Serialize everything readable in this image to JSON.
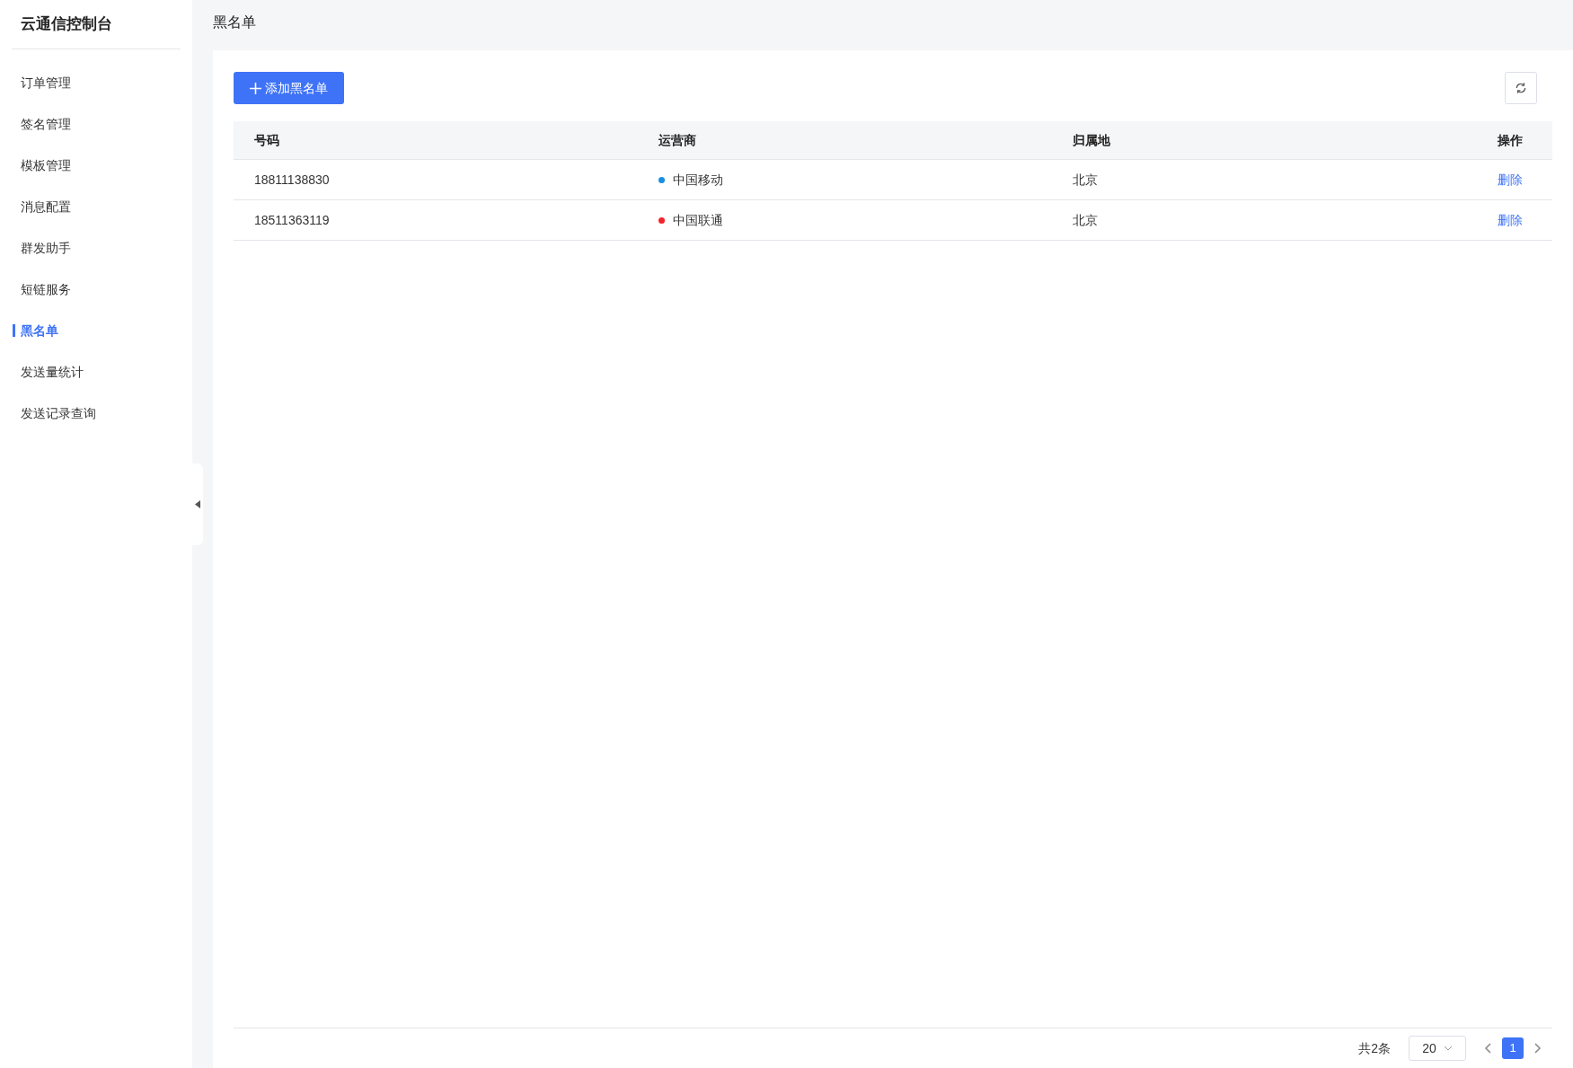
{
  "sidebar": {
    "title": "云通信控制台",
    "items": [
      {
        "label": "订单管理",
        "selected": false
      },
      {
        "label": "签名管理",
        "selected": false
      },
      {
        "label": "模板管理",
        "selected": false
      },
      {
        "label": "消息配置",
        "selected": false
      },
      {
        "label": "群发助手",
        "selected": false
      },
      {
        "label": "短链服务",
        "selected": false
      },
      {
        "label": "黑名单",
        "selected": true
      },
      {
        "label": "发送量统计",
        "selected": false
      },
      {
        "label": "发送记录查询",
        "selected": false
      }
    ]
  },
  "page_title": "黑名单",
  "toolbar": {
    "add_button": "添加黑名单"
  },
  "table": {
    "columns": [
      "号码",
      "运营商",
      "归属地",
      "操作"
    ],
    "rows": [
      {
        "number": "18811138830",
        "carrier": "中国移动",
        "color": "#1890e0",
        "location": "北京",
        "action": "删除"
      },
      {
        "number": "18511363119",
        "carrier": "中国联通",
        "color": "#f5222d",
        "location": "北京",
        "action": "删除"
      }
    ]
  },
  "pagination": {
    "total": "共2条",
    "page_size": "20",
    "pages": [
      {
        "label": "1",
        "selected": true
      }
    ]
  }
}
